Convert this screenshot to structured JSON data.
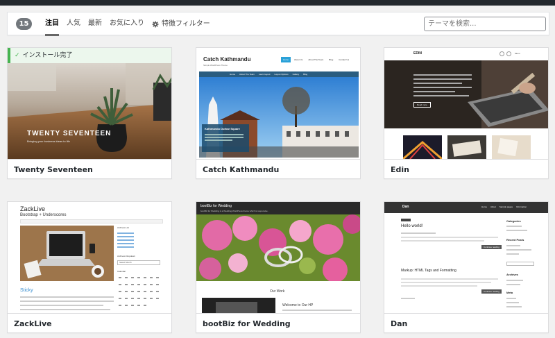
{
  "filter": {
    "count": "15",
    "tabs": [
      "注目",
      "人気",
      "最新",
      "お気に入り"
    ],
    "feature_filter": "特徴フィルター",
    "search_placeholder": "テーマを検索..."
  },
  "themes": [
    {
      "name": "Twenty Seventeen",
      "installed_notice": "インストール完了",
      "preview": {
        "title": "TWENTY SEVENTEEN",
        "tagline": "Bringing your business ideas to life"
      }
    },
    {
      "name": "Catch Kathmandu",
      "preview": {
        "site_title": "Catch Kathmandu",
        "tagline": "Simple WordPress Theme",
        "nav": [
          "Home",
          "About Us",
          "About The Team",
          "Blog",
          "Contact Us"
        ],
        "subnav": [
          "Home",
          "About The Team",
          "Learn layout",
          "Layout Options",
          "Gallery",
          "Blog"
        ],
        "slide_title": "Kathmandu Durbar Square"
      }
    },
    {
      "name": "Edin",
      "preview": {
        "site_title": "EDIN",
        "menu_label": "Menu",
        "button": "Read more"
      }
    },
    {
      "name": "ZackLive",
      "preview": {
        "site_title": "ZackLive",
        "tagline": "Bootstrap + Underscores",
        "post_title": "Sticky",
        "archives_list": "Archives List",
        "archives_dropdown": "Archives Dropdown",
        "dropdown_value": "Select Month",
        "calendar": "Calendar"
      }
    },
    {
      "name": "bootBiz for Wedding",
      "preview": {
        "brand": "bootBiz for Wedding",
        "tagline": "bootBiz for Wedding is a Wedding WordPress theme which is responsive.",
        "section": "Our Work",
        "welcome": "Welcome to Our HP"
      }
    },
    {
      "name": "Dan",
      "preview": {
        "site_title": "Dan",
        "nav": [
          "Home",
          "About",
          "Sample pages",
          "Information"
        ],
        "post1": "Hello world!",
        "post2": "Markup: HTML Tags and Formatting",
        "continue": "Continue reading",
        "sidebar": [
          "Categories",
          "Recent Posts",
          "Archives",
          "Meta"
        ]
      }
    }
  ]
}
